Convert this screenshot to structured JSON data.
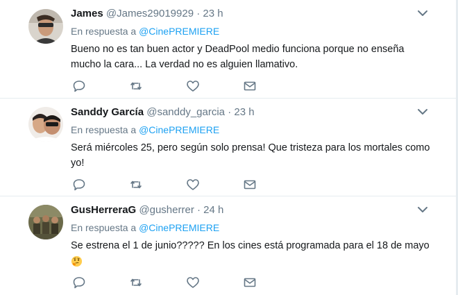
{
  "colors": {
    "link": "#1da1f2",
    "muted": "#657786",
    "text": "#14171a",
    "border": "#e6ecf0"
  },
  "tweets": [
    {
      "name": "James",
      "handle": "@James29019929",
      "dot": "·",
      "time": "23 h",
      "reply_prefix": "En respuesta a",
      "mention": "@CinePREMIERE",
      "text": "Bueno no es tan buen actor y DeadPool medio funciona porque no enseña mucho la cara... La verdad no es alguien llamativo."
    },
    {
      "name": "Sanddy García",
      "handle": "@sanddy_garcia",
      "dot": "·",
      "time": "23 h",
      "reply_prefix": "En respuesta a",
      "mention": "@CinePREMIERE",
      "text": "Será miércoles 25, pero según solo prensa! Que tristeza para los mortales como yo!"
    },
    {
      "name": "GusHerreraG",
      "handle": "@gusherrer",
      "dot": "·",
      "time": "24 h",
      "reply_prefix": "En respuesta a",
      "mention": "@CinePREMIERE",
      "text": "Se estrena el 1 de junio????? En los cines está programada para el 18 de mayo",
      "emoji": "thinking-face-emoji"
    }
  ],
  "icons": [
    "reply-icon",
    "retweet-icon",
    "like-icon",
    "direct-message-icon",
    "chevron-down-icon"
  ]
}
